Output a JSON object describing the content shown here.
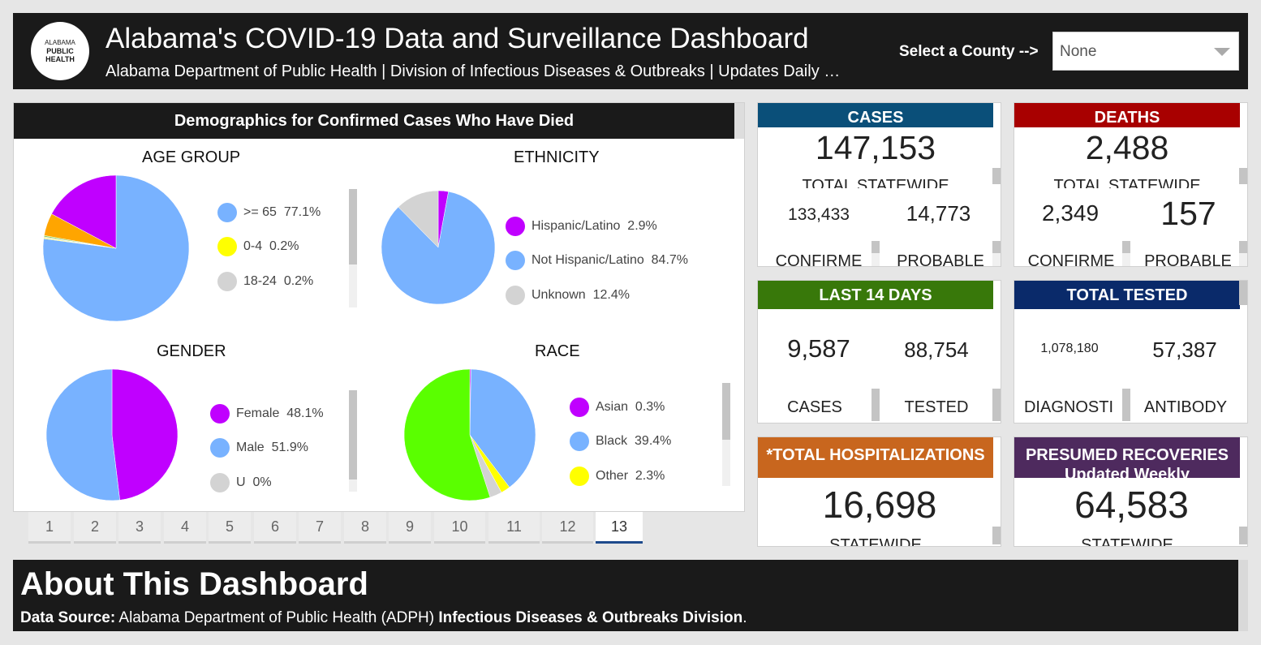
{
  "header": {
    "logo_lines": [
      "ALABAMA",
      "PUBLIC",
      "HEALTH"
    ],
    "title": "Alabama's COVID-19 Data and Surveillance Dashboard",
    "subtitle": "Alabama Department of Public Health | Division of Infectious Diseases & Outbreaks | Updates Daily …",
    "county_label": "Select a County -->",
    "county_value": "None"
  },
  "demographics": {
    "title": "Demographics for Confirmed Cases Who Have Died",
    "age": {
      "title": "AGE GROUP",
      "legend": [
        {
          "label": ">= 65",
          "value": "77.1%",
          "color": "#78b2ff"
        },
        {
          "label": "0-4",
          "value": "0.2%",
          "color": "#ffff00"
        },
        {
          "label": "18-24",
          "value": "0.2%",
          "color": "#d3d3d3"
        }
      ],
      "slices": [
        {
          "value": 77.1,
          "color": "#78b2ff"
        },
        {
          "value": 0.2,
          "color": "#ffff00"
        },
        {
          "value": 0.2,
          "color": "#d3d3d3"
        },
        {
          "value": 0.3,
          "color": "#90d050"
        },
        {
          "value": 5.0,
          "color": "#ffa500"
        },
        {
          "value": 17.2,
          "color": "#c000ff"
        }
      ]
    },
    "ethnicity": {
      "title": "ETHNICITY",
      "legend": [
        {
          "label": "Hispanic/Latino",
          "value": "2.9%",
          "color": "#c000ff"
        },
        {
          "label": "Not Hispanic/Latino",
          "value": "84.7%",
          "color": "#78b2ff"
        },
        {
          "label": "Unknown",
          "value": "12.4%",
          "color": "#d3d3d3"
        }
      ],
      "slices": [
        {
          "value": 2.9,
          "color": "#c000ff"
        },
        {
          "value": 84.7,
          "color": "#78b2ff"
        },
        {
          "value": 12.4,
          "color": "#d3d3d3"
        }
      ]
    },
    "gender": {
      "title": "GENDER",
      "legend": [
        {
          "label": "Female",
          "value": "48.1%",
          "color": "#c000ff"
        },
        {
          "label": "Male",
          "value": "51.9%",
          "color": "#78b2ff"
        },
        {
          "label": "U",
          "value": "0%",
          "color": "#d3d3d3"
        }
      ],
      "slices": [
        {
          "value": 48.1,
          "color": "#c000ff"
        },
        {
          "value": 51.9,
          "color": "#78b2ff"
        }
      ]
    },
    "race": {
      "title": "RACE",
      "legend": [
        {
          "label": "Asian",
          "value": "0.3%",
          "color": "#c000ff"
        },
        {
          "label": "Black",
          "value": "39.4%",
          "color": "#78b2ff"
        },
        {
          "label": "Other",
          "value": "2.3%",
          "color": "#ffff00"
        }
      ],
      "slices": [
        {
          "value": 0.3,
          "color": "#c000ff"
        },
        {
          "value": 39.4,
          "color": "#78b2ff"
        },
        {
          "value": 2.3,
          "color": "#ffff00"
        },
        {
          "value": 3.0,
          "color": "#d3d3d3"
        },
        {
          "value": 55.0,
          "color": "#5aff00"
        }
      ]
    }
  },
  "pager": [
    "1",
    "2",
    "3",
    "4",
    "5",
    "6",
    "7",
    "8",
    "9",
    "10",
    "11",
    "12",
    "13"
  ],
  "pager_active": "13",
  "cards": {
    "cases": {
      "title": "CASES",
      "color": "#0a4f79",
      "total": "147,153",
      "total_label": "TOTAL STATEWIDE",
      "left_value": "133,433",
      "left_label": "CONFIRME",
      "right_value": "14,773",
      "right_label": "PROBABLE"
    },
    "deaths": {
      "title": "DEATHS",
      "color": "#a80000",
      "total": "2,488",
      "total_label": "TOTAL STATEWIDE",
      "left_value": "2,349",
      "left_label": "CONFIRME",
      "right_value": "157",
      "right_label": "PROBABLE"
    },
    "last14": {
      "title": "LAST 14 DAYS",
      "color": "#38780a",
      "left_value": "9,587",
      "left_label": "CASES",
      "right_value": "88,754",
      "right_label": "TESTED"
    },
    "tested": {
      "title": "TOTAL TESTED",
      "color": "#0a2a6a",
      "left_value": "1,078,180",
      "left_label": "DIAGNOSTI",
      "right_value": "57,387",
      "right_label": "ANTIBODY"
    },
    "hosp": {
      "title": "*TOTAL HOSPITALIZATIONS",
      "color": "#c8661e",
      "value": "16,698",
      "label": "STATEWIDE"
    },
    "recov": {
      "title": "PRESUMED RECOVERIES Updated Weekly",
      "color": "#4e2a5e",
      "value": "64,583",
      "label": "STATEWIDE"
    }
  },
  "about": {
    "title": "About This Dashboard",
    "source_label": "Data Source:",
    "source_text": " Alabama Department of Public Health (ADPH) ",
    "source_bold": "Infectious Diseases & Outbreaks Division",
    "source_end": "."
  }
}
